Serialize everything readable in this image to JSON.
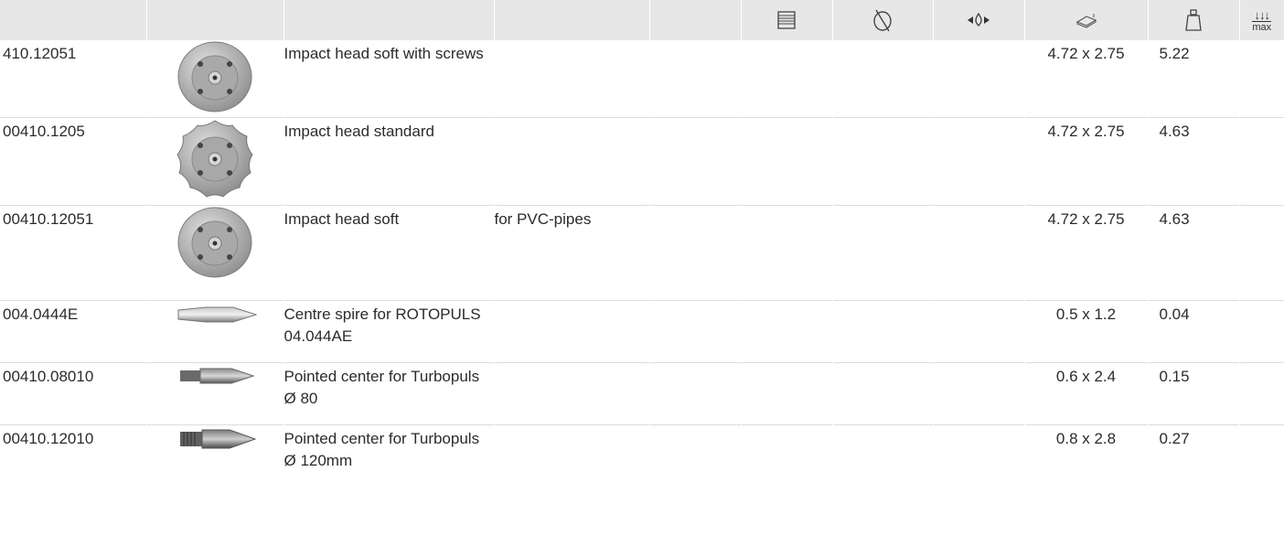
{
  "header": {
    "icons": [
      "coil-length-icon",
      "diameter-icon",
      "flow-direction-icon",
      "dimensions-icon",
      "weight-icon",
      "max-load-icon"
    ],
    "max_label": "max"
  },
  "rows": [
    {
      "id": "410.12051",
      "image": "impact-head-round",
      "description": "Impact head soft with screws",
      "note": "",
      "dimensions": "4.72 x 2.75",
      "weight": "5.22"
    },
    {
      "id": "00410.1205",
      "image": "impact-head-star",
      "description": "Impact head standard",
      "note": "",
      "dimensions": "4.72 x 2.75",
      "weight": "4.63"
    },
    {
      "id": "00410.12051",
      "image": "impact-head-round",
      "description": "Impact head soft",
      "note": "for PVC-pipes",
      "dimensions": "4.72 x 2.75",
      "weight": "4.63"
    },
    {
      "id": "004.0444E",
      "image": "centre-spire",
      "description": "Centre spire for ROTOPULS 04.044AE",
      "note": "",
      "dimensions": "0.5 x 1.2",
      "weight": "0.04"
    },
    {
      "id": "00410.08010",
      "image": "pointed-center-small",
      "description": "Pointed center for Turbopuls Ø 80",
      "note": "",
      "dimensions": "0.6 x 2.4",
      "weight": "0.15"
    },
    {
      "id": "00410.12010",
      "image": "pointed-center-large",
      "description": "Pointed center for Turbopuls Ø 120mm",
      "note": "",
      "dimensions": "0.8 x 2.8",
      "weight": "0.27"
    }
  ]
}
